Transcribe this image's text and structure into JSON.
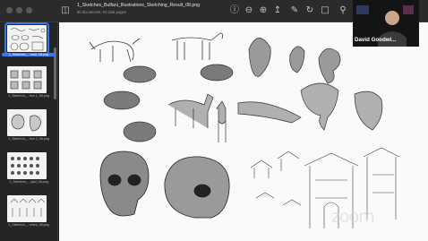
{
  "window": {
    "title": "1_Sketches_Bulfani_Illustrations_Sketching_Result_08.png",
    "subtitle": "80 documents, 93 total pages"
  },
  "toolbar": {
    "icons": [
      "sidebar-icon",
      "info-icon",
      "zoom-out-icon",
      "zoom-in-icon",
      "share-icon",
      "markup-icon",
      "rotate-icon",
      "crop-icon",
      "search-icon"
    ]
  },
  "sidebar": {
    "items": [
      {
        "label": "1_Sketches_...esult_08.png",
        "selected": true
      },
      {
        "label": "1_Sketches_...tion 1_08.png",
        "selected": false
      },
      {
        "label": "1_Sketches_...tion 2_08.png",
        "selected": false
      },
      {
        "label": "1_Sketches_...yaki_08.png",
        "selected": false
      },
      {
        "label": "1_Sketches_...tches_08.png",
        "selected": false
      }
    ]
  },
  "video": {
    "participant_name": "David Goodwi..."
  },
  "watermark": "zoom",
  "colors": {
    "accent": "#3478f6",
    "canvas": "#fafafa"
  }
}
